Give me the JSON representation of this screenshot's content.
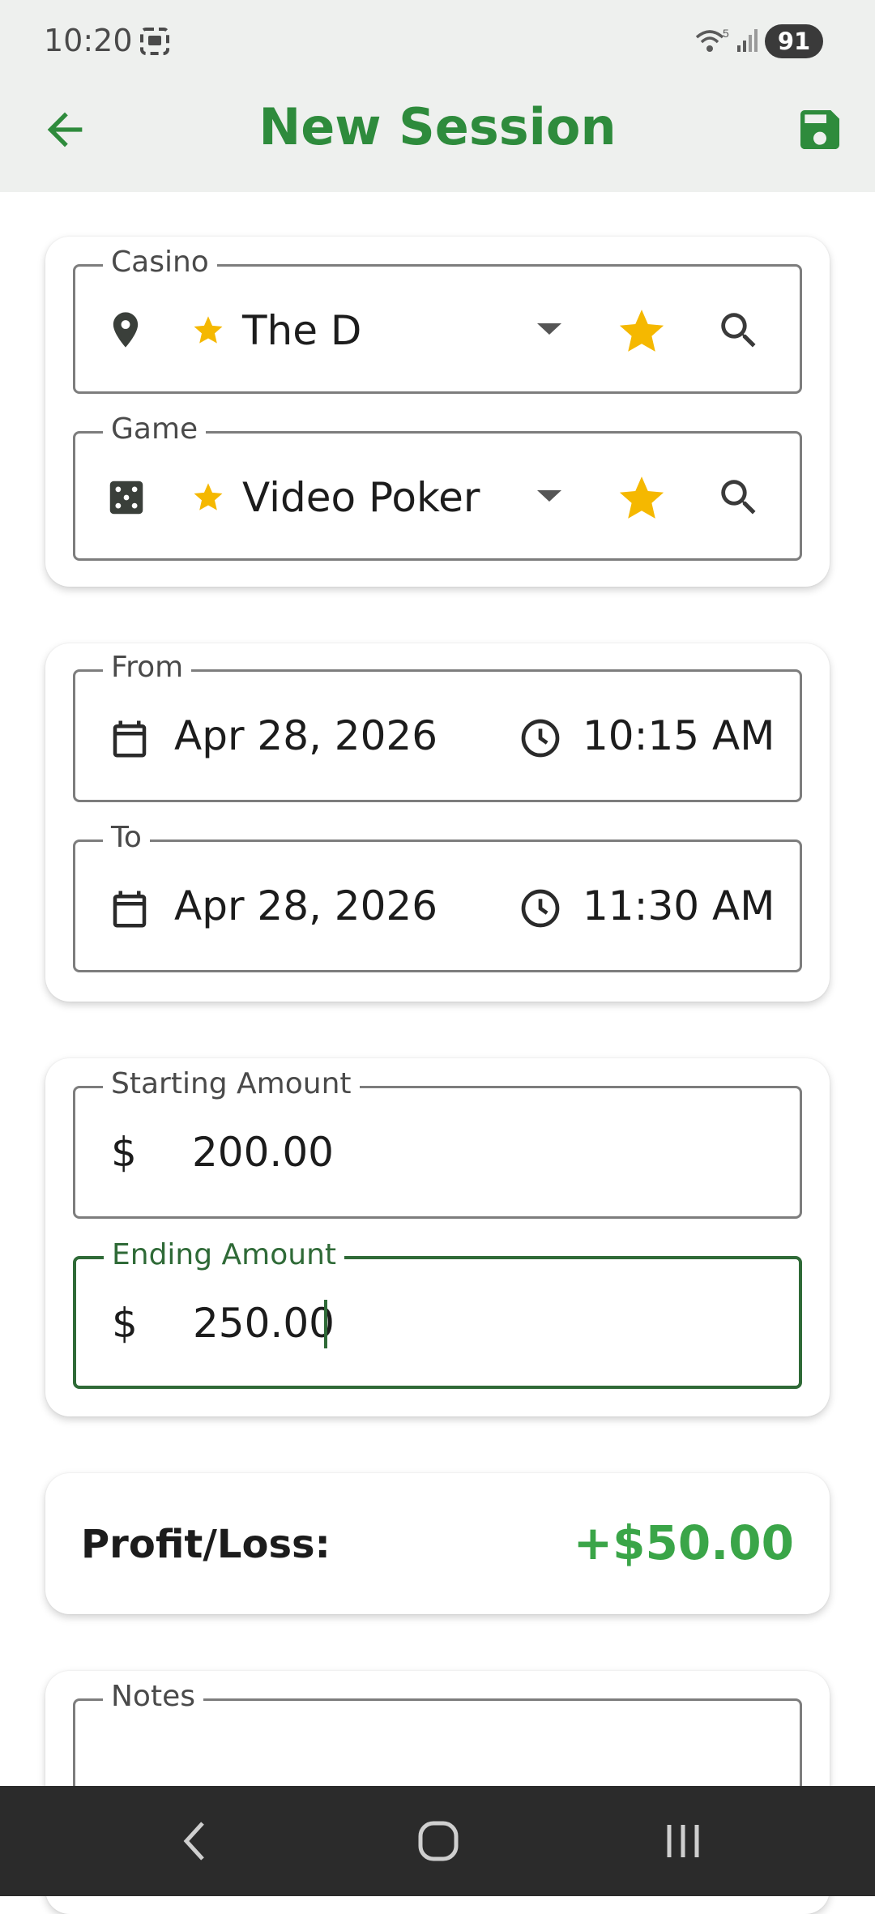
{
  "status_bar": {
    "time": "10:20",
    "battery": "91"
  },
  "app_bar": {
    "title": "New Session"
  },
  "location": {
    "casino": {
      "label": "Casino",
      "value": "The D"
    },
    "game": {
      "label": "Game",
      "value": "Video Poker"
    }
  },
  "time_range": {
    "from": {
      "label": "From",
      "date": "Apr 28, 2026",
      "time": "10:15 AM"
    },
    "to": {
      "label": "To",
      "date": "Apr 28, 2026",
      "time": "11:30 AM"
    }
  },
  "amounts": {
    "starting": {
      "label": "Starting Amount",
      "currency": "$",
      "value": "200.00"
    },
    "ending": {
      "label": "Ending Amount",
      "currency": "$",
      "value": "250.00"
    }
  },
  "result": {
    "label": "Profit/Loss:",
    "value": "+$50.00"
  },
  "notes": {
    "label": "Notes"
  },
  "colors": {
    "accent": "#2e8b3c",
    "profit": "#3aa548",
    "star": "#f5b800",
    "focus": "#2f6a37"
  }
}
